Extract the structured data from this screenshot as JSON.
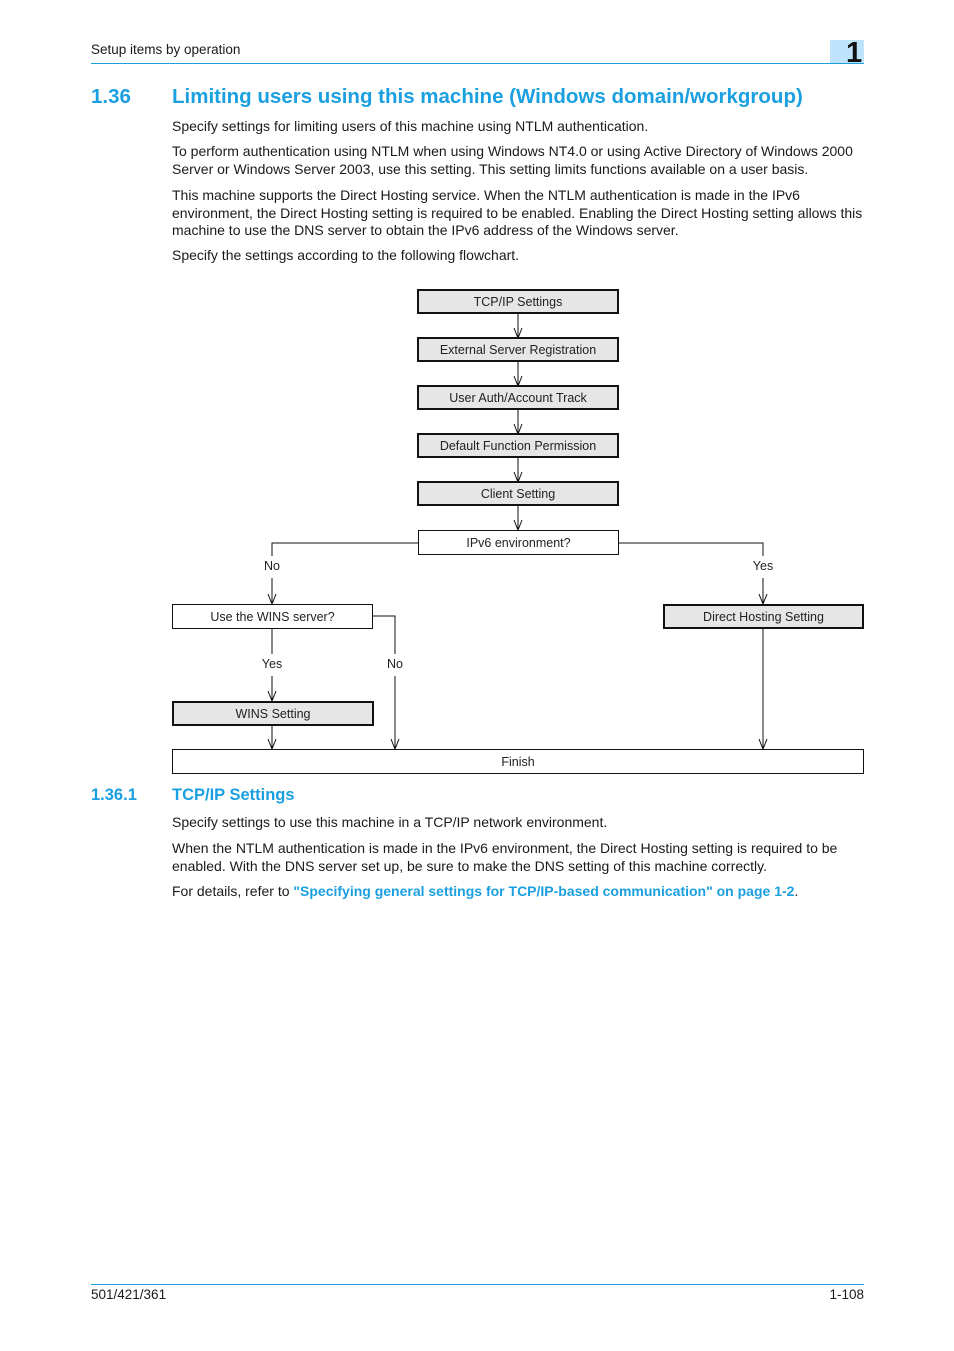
{
  "header": {
    "section_title": "Setup items by operation",
    "chapter_number": "1"
  },
  "section": {
    "number": "1.36",
    "title": "Limiting users using this machine (Windows domain/workgroup)",
    "paragraphs": [
      "Specify settings for limiting users of this machine using NTLM authentication.",
      "To perform authentication using NTLM when using Windows NT4.0 or using Active Directory of Windows 2000 Server or Windows Server 2003, use this setting. This setting limits functions available on a user basis.",
      "This machine supports the Direct Hosting service. When the NTLM authentication is made in the IPv6 environment, the Direct Hosting setting is required to be enabled. Enabling the Direct Hosting setting allows this machine to use the DNS server to obtain the IPv6 address of the Windows server.",
      "Specify the settings according to the following flowchart."
    ]
  },
  "flowchart": {
    "steps": [
      "TCP/IP Settings",
      "External Server Registration",
      "User Auth/Account Track",
      "Default Function Permission",
      "Client Setting"
    ],
    "decision_ipv6": "IPv6 environment?",
    "decision_wins": "Use the WINS server?",
    "wins_setting": "WINS Setting",
    "direct_hosting": "Direct Hosting Setting",
    "finish": "Finish",
    "labels": {
      "ipv6_no": "No",
      "ipv6_yes": "Yes",
      "wins_yes": "Yes",
      "wins_no": "No"
    }
  },
  "subsection": {
    "number": "1.36.1",
    "title": "TCP/IP Settings",
    "para1": "Specify settings to use this machine in a TCP/IP network environment.",
    "para2": "When the NTLM authentication is made in the IPv6 environment, the Direct Hosting setting is required to be enabled. With the DNS server set up, be sure to make the DNS setting of this machine correctly.",
    "para3_prefix": "For details, refer to ",
    "para3_link": "\"Specifying general settings for TCP/IP-based communication\" on page 1-2",
    "para3_suffix": "."
  },
  "footer": {
    "model": "501/421/361",
    "page": "1-108"
  }
}
